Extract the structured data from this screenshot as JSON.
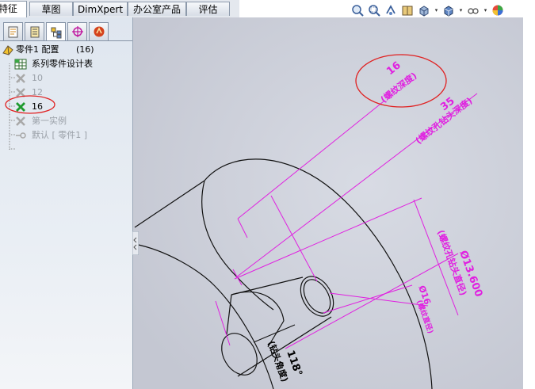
{
  "tabs": [
    {
      "label": "特征",
      "active": true
    },
    {
      "label": "草图",
      "active": false
    },
    {
      "label": "DimXpert",
      "active": false
    },
    {
      "label": "办公室产品",
      "active": false
    },
    {
      "label": "评估",
      "active": false
    }
  ],
  "view_toolbar": {
    "icons": [
      "zoom-to-fit-icon",
      "zoom-area-icon",
      "previous-view-icon",
      "section-view-icon",
      "view-orientation-icon",
      "display-style-icon",
      "hide-show-icon",
      "appearance-icon"
    ]
  },
  "feature_tree": {
    "pane_tabs": [
      "feature-manager-tab",
      "property-manager-tab",
      "configuration-manager-tab",
      "dimxpert-manager-tab"
    ],
    "root_label": "零件1 配置",
    "root_count": "(16)",
    "design_table_label": "系列零件设计表",
    "configs": [
      {
        "label": "10",
        "active": false
      },
      {
        "label": "12",
        "active": false
      },
      {
        "label": "16",
        "active": true
      }
    ],
    "first_instance_label": "第一实例",
    "default_label": "默认 [ 零件1 ]"
  },
  "drawing": {
    "dimension_color": "#e020e0",
    "annotations": [
      {
        "value": "16",
        "desc": "(螺纹深度)"
      },
      {
        "value": "35",
        "desc": "(螺纹孔钻头深度)"
      },
      {
        "value": "Ø13.600",
        "desc": "(螺纹孔钻头直径)"
      },
      {
        "value": "Ø16",
        "desc": "(螺纹直径)"
      },
      {
        "value": "118°",
        "desc": "(钻头角度)"
      }
    ],
    "highlight_color": "#e02020"
  }
}
